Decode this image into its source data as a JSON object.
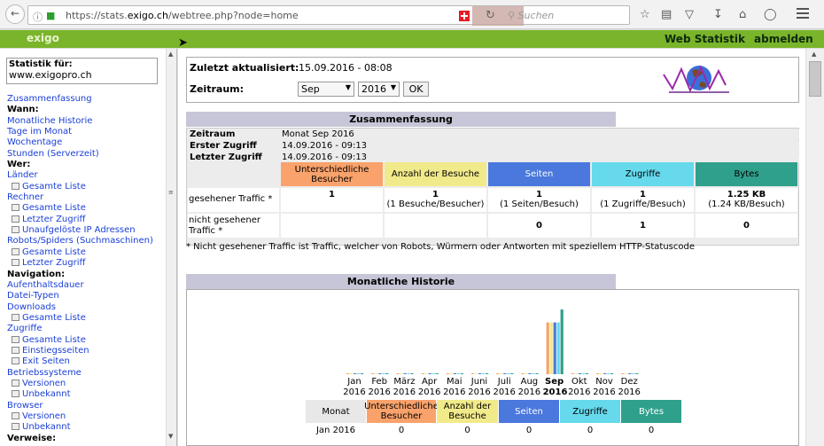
{
  "browser": {
    "url_prefix": "https://stats.",
    "url_domain": "exigo.ch",
    "url_path": "/webtree.php?node=home",
    "search_placeholder": "Suchen"
  },
  "header": {
    "logo": "exigo",
    "title": "Web Statistik",
    "logout": "abmelden"
  },
  "sidebar": {
    "stats_for_label": "Statistik für:",
    "domain": "www.exigopro.ch",
    "items": [
      {
        "type": "link",
        "label": "Zusammenfassung"
      },
      {
        "type": "head",
        "label": "Wann:"
      },
      {
        "type": "link",
        "label": "Monatliche Historie"
      },
      {
        "type": "link",
        "label": "Tage im Monat"
      },
      {
        "type": "link",
        "label": "Wochentage"
      },
      {
        "type": "link",
        "label": "Stunden (Serverzeit)"
      },
      {
        "type": "head",
        "label": "Wer:"
      },
      {
        "type": "link",
        "label": "Länder"
      },
      {
        "type": "sub",
        "label": "Gesamte Liste"
      },
      {
        "type": "link",
        "label": "Rechner"
      },
      {
        "type": "sub",
        "label": "Gesamte Liste"
      },
      {
        "type": "sub",
        "label": "Letzter Zugriff"
      },
      {
        "type": "sub",
        "label": "Unaufgelöste IP Adressen"
      },
      {
        "type": "link",
        "label": "Robots/Spiders (Suchmaschinen)"
      },
      {
        "type": "sub",
        "label": "Gesamte Liste"
      },
      {
        "type": "sub",
        "label": "Letzter Zugriff"
      },
      {
        "type": "head",
        "label": "Navigation:"
      },
      {
        "type": "link",
        "label": "Aufenthaltsdauer"
      },
      {
        "type": "link",
        "label": "Datei-Typen"
      },
      {
        "type": "link",
        "label": "Downloads"
      },
      {
        "type": "sub",
        "label": "Gesamte Liste"
      },
      {
        "type": "link",
        "label": "Zugriffe"
      },
      {
        "type": "sub",
        "label": "Gesamte Liste"
      },
      {
        "type": "sub",
        "label": "Einstiegsseiten"
      },
      {
        "type": "sub",
        "label": "Exit Seiten"
      },
      {
        "type": "link",
        "label": "Betriebssysteme"
      },
      {
        "type": "sub",
        "label": "Versionen"
      },
      {
        "type": "sub",
        "label": "Unbekannt"
      },
      {
        "type": "link",
        "label": "Browser"
      },
      {
        "type": "sub",
        "label": "Versionen"
      },
      {
        "type": "sub",
        "label": "Unbekannt"
      },
      {
        "type": "head",
        "label": "Verweise:"
      }
    ]
  },
  "info": {
    "last_update_label": "Zuletzt aktualisiert:",
    "last_update": "15.09.2016 - 08:08",
    "period_label": "Zeitraum:",
    "month": "Sep",
    "year": "2016",
    "ok": "OK"
  },
  "summary": {
    "title": "Zusammenfassung",
    "rows": [
      {
        "k": "Zeitraum",
        "v": "Monat Sep 2016"
      },
      {
        "k": "Erster Zugriff",
        "v": "14.09.2016 - 09:13"
      },
      {
        "k": "Letzter Zugriff",
        "v": "14.09.2016 - 09:13"
      }
    ],
    "columns": [
      {
        "label": "Unterschiedliche Besucher",
        "color": "#f9a26b"
      },
      {
        "label": "Anzahl der Besuche",
        "color": "#f1ea8a"
      },
      {
        "label": "Seiten",
        "color": "#4a78dc"
      },
      {
        "label": "Zugriffe",
        "color": "#66d9ec"
      },
      {
        "label": "Bytes",
        "color": "#2fa08c"
      }
    ],
    "seen_label": "gesehener Traffic *",
    "seen": [
      {
        "main": "1",
        "sub": ""
      },
      {
        "main": "1",
        "sub": "(1 Besuche/Besucher)"
      },
      {
        "main": "1",
        "sub": "(1 Seiten/Besuch)"
      },
      {
        "main": "1",
        "sub": "(1 Zugriffe/Besuch)"
      },
      {
        "main": "1.25 KB",
        "sub": "(1.24 KB/Besuch)"
      }
    ],
    "unseen_label_1": "nicht gesehener",
    "unseen_label_2": "Traffic *",
    "unseen": [
      "",
      "",
      "0",
      "1",
      "0"
    ],
    "footnote": "* Nicht gesehener Traffic ist Traffic, welcher von Robots, Würmern oder Antworten mit speziellem HTTP-Statuscode"
  },
  "history": {
    "title": "Monatliche Historie",
    "table_headers": [
      "Monat",
      "Unterschiedliche Besucher",
      "Anzahl der Besuche",
      "Seiten",
      "Zugriffe",
      "Bytes"
    ],
    "first_row": [
      "Jan 2016",
      "0",
      "0",
      "0",
      "0",
      "0"
    ]
  },
  "chart_data": {
    "type": "bar",
    "categories": [
      "Jan 2016",
      "Feb 2016",
      "März 2016",
      "Apr 2016",
      "Mai 2016",
      "Juni 2016",
      "Juli 2016",
      "Aug 2016",
      "Sep 2016",
      "Okt 2016",
      "Nov 2016",
      "Dez 2016"
    ],
    "months": [
      "Jan",
      "Feb",
      "März",
      "Apr",
      "Mai",
      "Juni",
      "Juli",
      "Aug",
      "Sep",
      "Okt",
      "Nov",
      "Dez"
    ],
    "years": [
      "2016",
      "2016",
      "2016",
      "2016",
      "2016",
      "2016",
      "2016",
      "2016",
      "2016",
      "2016",
      "2016",
      "2016"
    ],
    "highlight": "Sep 2016",
    "series": [
      {
        "name": "Unterschiedliche Besucher",
        "color": "#f9a26b",
        "values": [
          0,
          0,
          0,
          0,
          0,
          0,
          0,
          0,
          1,
          0,
          0,
          0
        ]
      },
      {
        "name": "Anzahl der Besuche",
        "color": "#f1ea8a",
        "values": [
          0,
          0,
          0,
          0,
          0,
          0,
          0,
          0,
          1,
          0,
          0,
          0
        ]
      },
      {
        "name": "Seiten",
        "color": "#4a78dc",
        "values": [
          0,
          0,
          0,
          0,
          0,
          0,
          0,
          0,
          1,
          0,
          0,
          0
        ]
      },
      {
        "name": "Zugriffe",
        "color": "#66d9ec",
        "values": [
          0,
          0,
          0,
          0,
          0,
          0,
          0,
          0,
          1,
          0,
          0,
          0
        ]
      },
      {
        "name": "Bytes",
        "color": "#2fa08c",
        "values": [
          0,
          0,
          0,
          0,
          0,
          0,
          0,
          0,
          1.25,
          0,
          0,
          0
        ]
      }
    ]
  }
}
